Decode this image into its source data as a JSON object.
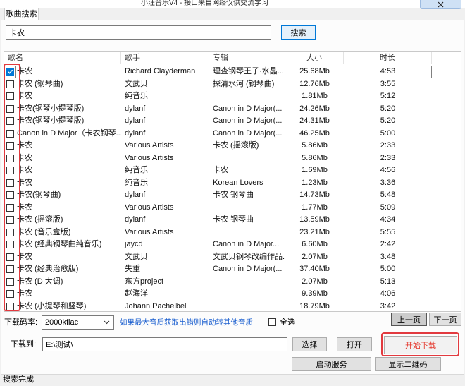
{
  "window": {
    "title": "小汪音乐V4 - 接口来自网络仅供交流学习",
    "close_icon": "close-icon"
  },
  "tabs": [
    "歌曲搜索"
  ],
  "search": {
    "value": "卡农",
    "button_label": "搜索"
  },
  "table": {
    "columns": [
      "歌名",
      "歌手",
      "专辑",
      "大小",
      "时长"
    ],
    "rows": [
      {
        "checked": true,
        "selected": true,
        "name": "卡农",
        "artist": "Richard Clayderman",
        "album": "理查钢琴王子·水晶...",
        "size": "25.68Mb",
        "duration": "4:53"
      },
      {
        "checked": false,
        "name": "卡农 (钢琴曲)",
        "artist": "文武贝",
        "album": "探清水河 (钢琴曲)",
        "size": "12.76Mb",
        "duration": "3:55"
      },
      {
        "checked": false,
        "name": "卡农",
        "artist": "纯音乐",
        "album": "",
        "size": "1.81Mb",
        "duration": "5:12"
      },
      {
        "checked": false,
        "name": "卡农(钢琴小提琴版)",
        "artist": "dylanf",
        "album": "Canon in D Major(...",
        "size": "24.26Mb",
        "duration": "5:20"
      },
      {
        "checked": false,
        "name": "卡农(钢琴小提琴版)",
        "artist": "dylanf",
        "album": "Canon in D Major(...",
        "size": "24.31Mb",
        "duration": "5:20"
      },
      {
        "checked": false,
        "name": "Canon in D Major（卡农钢琴...",
        "artist": "dylanf",
        "album": "Canon in D Major(...",
        "size": "46.25Mb",
        "duration": "5:00"
      },
      {
        "checked": false,
        "name": "卡农",
        "artist": "Various Artists",
        "album": "卡农 (摇滚版)",
        "size": "5.86Mb",
        "duration": "2:33"
      },
      {
        "checked": false,
        "name": "卡农",
        "artist": "Various Artists",
        "album": "",
        "size": "5.86Mb",
        "duration": "2:33"
      },
      {
        "checked": false,
        "name": "卡农",
        "artist": "纯音乐",
        "album": "卡农",
        "size": "1.69Mb",
        "duration": "4:56"
      },
      {
        "checked": false,
        "name": "卡农",
        "artist": "纯音乐",
        "album": "Korean Lovers",
        "size": "1.23Mb",
        "duration": "3:36"
      },
      {
        "checked": false,
        "name": "卡农(钢琴曲)",
        "artist": "dylanf",
        "album": "卡农 钢琴曲",
        "size": "14.73Mb",
        "duration": "5:48"
      },
      {
        "checked": false,
        "name": "卡农",
        "artist": "Various Artists",
        "album": "",
        "size": "1.77Mb",
        "duration": "5:09"
      },
      {
        "checked": false,
        "name": "卡农 (摇滚版)",
        "artist": "dylanf",
        "album": "卡农 钢琴曲",
        "size": "13.59Mb",
        "duration": "4:34"
      },
      {
        "checked": false,
        "name": "卡农 (音乐盒版)",
        "artist": "Various Artists",
        "album": "",
        "size": "23.21Mb",
        "duration": "5:55"
      },
      {
        "checked": false,
        "name": "卡农 (经典钢琴曲纯音乐)",
        "artist": "jaycd",
        "album": "Canon in D Major...",
        "size": "6.60Mb",
        "duration": "2:42"
      },
      {
        "checked": false,
        "name": "卡农",
        "artist": "文武贝",
        "album": "文武贝钢琴改编作品...",
        "size": "2.07Mb",
        "duration": "3:48"
      },
      {
        "checked": false,
        "name": "卡农 (经典治愈版)",
        "artist": "失重",
        "album": "Canon in D Major(...",
        "size": "37.40Mb",
        "duration": "5:00"
      },
      {
        "checked": false,
        "name": "卡农 (D 大调)",
        "artist": "东方project",
        "album": "",
        "size": "2.07Mb",
        "duration": "5:13"
      },
      {
        "checked": false,
        "name": "卡农",
        "artist": "赵海洋",
        "album": "",
        "size": "9.39Mb",
        "duration": "4:06"
      },
      {
        "checked": false,
        "name": "卡农 (小提琴和竖琴)",
        "artist": "Johann Pachelbel",
        "album": "",
        "size": "18.79Mb",
        "duration": "3:42"
      }
    ]
  },
  "bitrate": {
    "label": "下载码率:",
    "value": "2000kflac",
    "dropdown_icon": "chevron-down-icon",
    "hint": "如果最大音质获取出错则自动转其他音质"
  },
  "select_all": {
    "label": "全选",
    "checked": false
  },
  "pager": {
    "prev_label": "上一页",
    "next_label": "下一页"
  },
  "download_path": {
    "label": "下载到:",
    "value": "E:\\测试\\",
    "choose_label": "选择",
    "open_label": "打开"
  },
  "actions": {
    "start_download_label": "开始下载",
    "start_service_label": "启动服务",
    "show_qr_label": "显示二维码"
  },
  "status": {
    "text": "搜索完成"
  },
  "icons": {
    "check": "check-icon"
  },
  "colors": {
    "accent": "#0078d7",
    "hint_text": "#1b5fcf",
    "start_download_text": "#e53a2f",
    "annotation": "#e23a3f"
  }
}
